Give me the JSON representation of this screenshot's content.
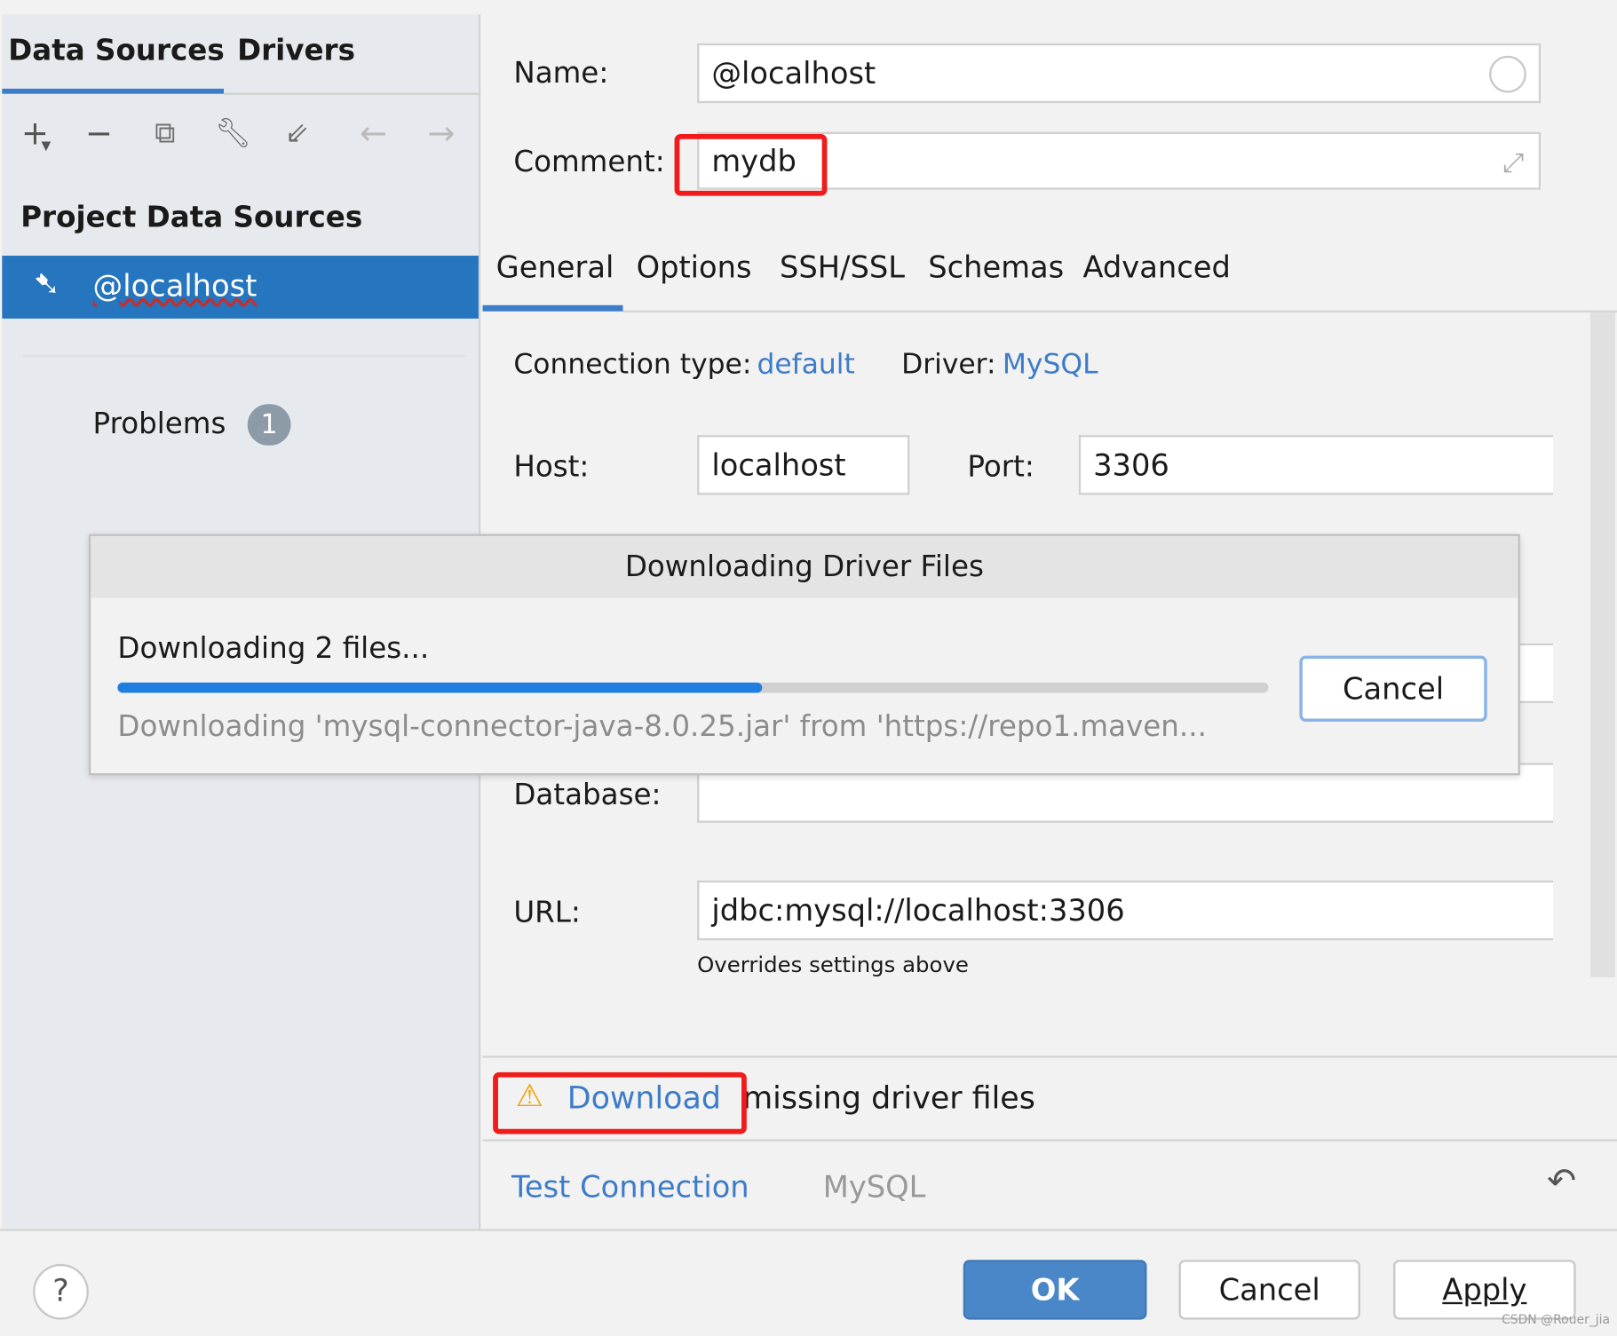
{
  "sidebar": {
    "tabs": [
      "Data Sources",
      "Drivers"
    ],
    "active_tab": "Data Sources",
    "toolbar_icons": [
      "plus-icon",
      "minus-icon",
      "copy-icon",
      "wrench-icon",
      "import-icon",
      "back-arrow-icon",
      "forward-arrow-icon"
    ],
    "section_title": "Project Data Sources",
    "items": [
      {
        "label": "@localhost",
        "icon": "mysql-dolphin-icon",
        "selected": true
      }
    ],
    "problems_label": "Problems",
    "problems_count": "1"
  },
  "form": {
    "name_label": "Name:",
    "name_value": "@localhost",
    "comment_label": "Comment:",
    "comment_value": "mydb",
    "tabs": [
      "General",
      "Options",
      "SSH/SSL",
      "Schemas",
      "Advanced"
    ],
    "active_tab": "General",
    "connection_type_label": "Connection type:",
    "connection_type_value": "default",
    "driver_label": "Driver:",
    "driver_value": "MySQL",
    "host_label": "Host:",
    "host_value": "localhost",
    "port_label": "Port:",
    "port_value": "3306",
    "database_label": "Database:",
    "database_value": "",
    "url_label": "URL:",
    "url_value": "jdbc:mysql://localhost:3306",
    "url_hint": "Overrides settings above"
  },
  "download_bar": {
    "link": "Download",
    "text": "missing driver files"
  },
  "bottom_bar": {
    "test_connection": "Test Connection",
    "driver_name": "MySQL"
  },
  "buttons": {
    "ok": "OK",
    "cancel": "Cancel",
    "apply": "Apply"
  },
  "progress_dialog": {
    "title": "Downloading Driver Files",
    "status": "Downloading 2 files...",
    "progress_percent": 56,
    "detail": "Downloading 'mysql-connector-java-8.0.25.jar' from 'https://repo1.maven...",
    "cancel": "Cancel"
  },
  "watermark": "CSDN @Rouer_jia",
  "colors": {
    "accent": "#2675bf",
    "link": "#3d7cc9",
    "highlight_box": "#f01b1b",
    "warning": "#f0a30a",
    "progress": "#1f7ee0"
  }
}
